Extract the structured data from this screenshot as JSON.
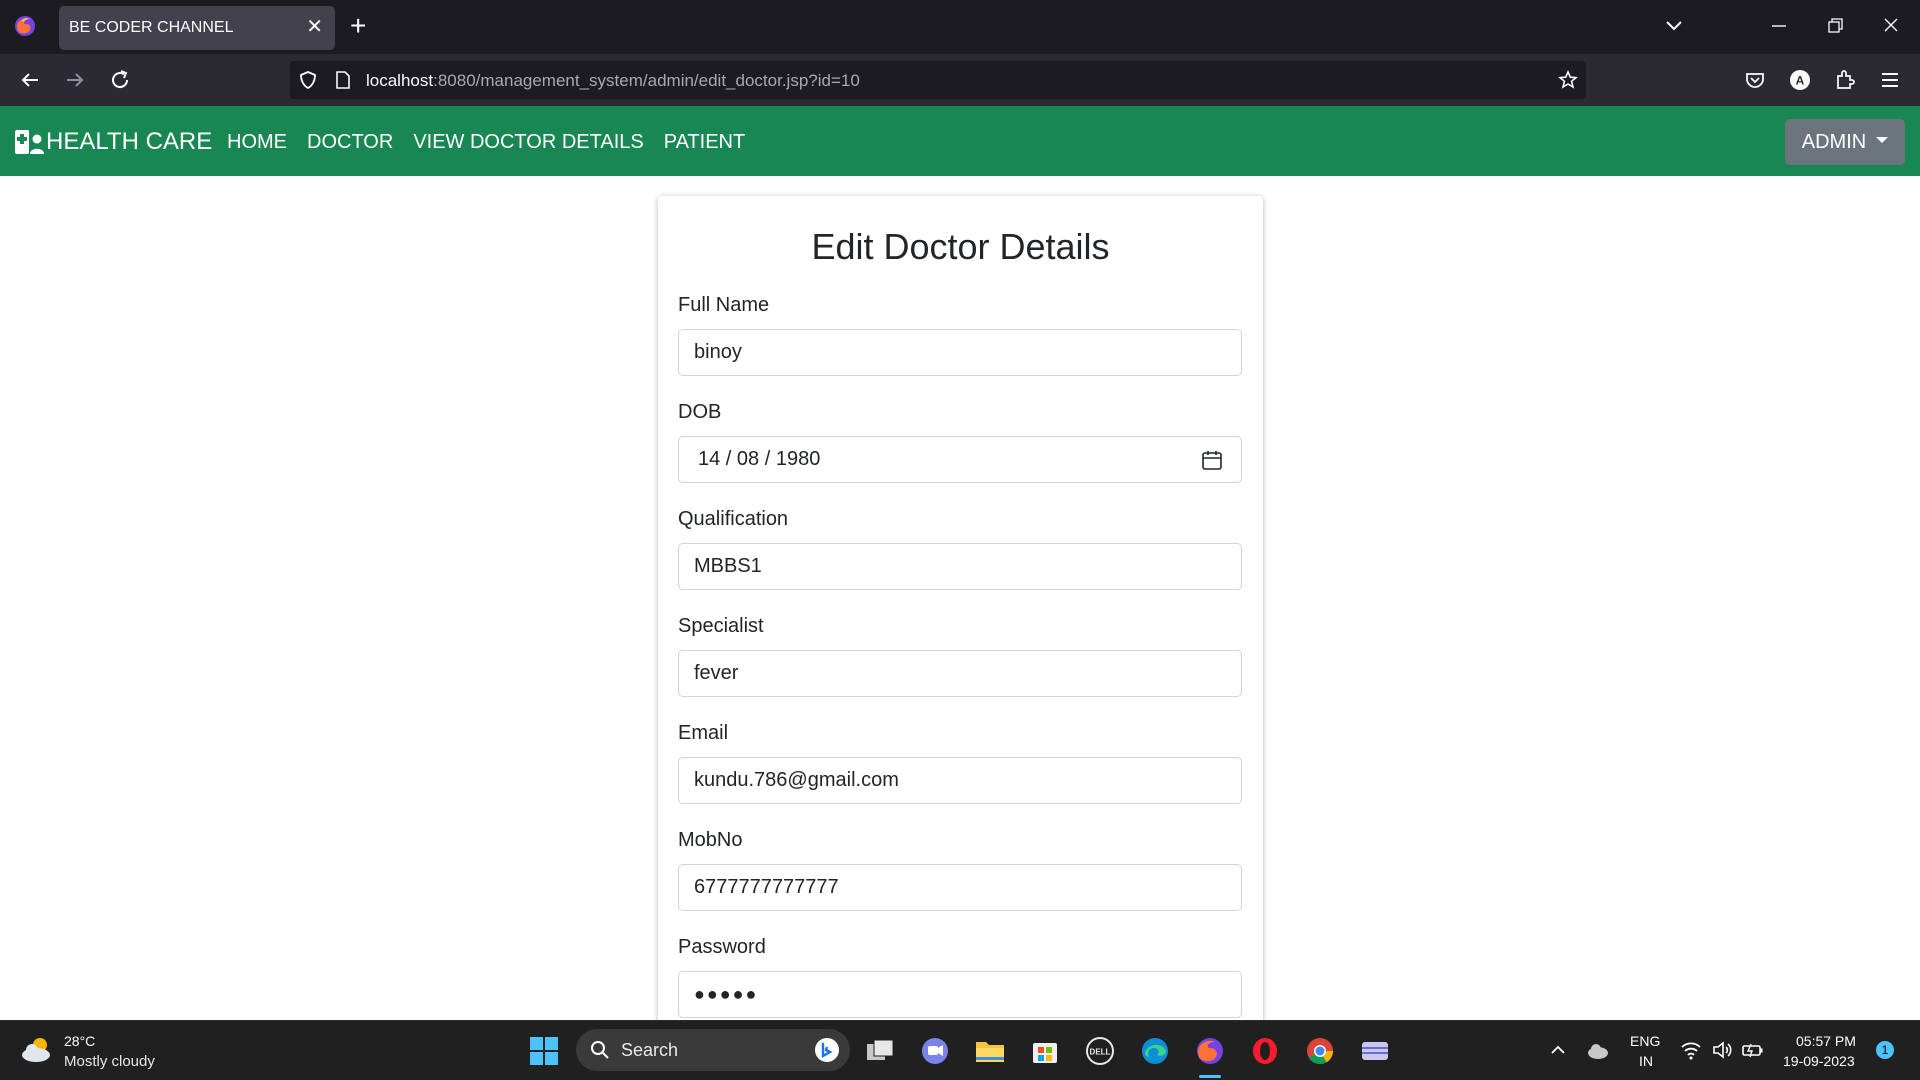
{
  "browser": {
    "tab_title": "BE CODER CHANNEL",
    "url_host": "localhost",
    "url_rest": ":8080/management_system/admin/edit_doctor.jsp?id=10"
  },
  "appnav": {
    "brand": "HEALTH CARE",
    "links": [
      "HOME",
      "DOCTOR",
      "VIEW DOCTOR DETAILS",
      "PATIENT"
    ],
    "admin_label": "ADMIN"
  },
  "form": {
    "title": "Edit Doctor Details",
    "fields": [
      {
        "label": "Full Name",
        "value": "binoy"
      },
      {
        "label": "DOB",
        "value": "14 / 08 / 1980"
      },
      {
        "label": "Qualification",
        "value": "MBBS1"
      },
      {
        "label": "Specialist",
        "value": "fever"
      },
      {
        "label": "Email",
        "value": "kundu.786@gmail.com"
      },
      {
        "label": "MobNo",
        "value": "6777777777777"
      },
      {
        "label": "Password",
        "value": "●●●●●"
      }
    ]
  },
  "taskbar": {
    "temp": "28°C",
    "weather": "Mostly cloudy",
    "search_label": "Search",
    "lang_top": "ENG",
    "lang_bottom": "IN",
    "time": "05:57 PM",
    "date": "19-09-2023",
    "notifications": "1"
  }
}
